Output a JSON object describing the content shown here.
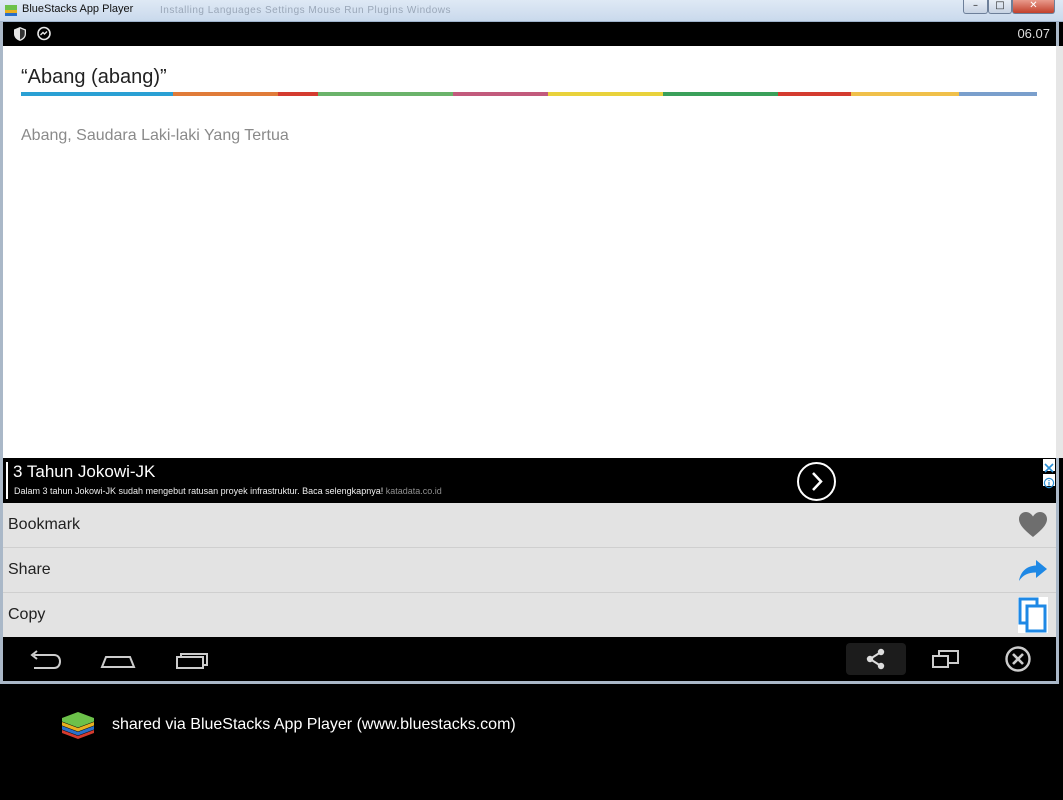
{
  "window": {
    "title": "BlueStacks App Player",
    "ghost_menu": "Installing   Languages   Settings   Mouse   Run   Plugins   Windows",
    "min_label": "–",
    "max_label": "□",
    "close_label": "✕"
  },
  "statusbar": {
    "time": "06.07",
    "icons": [
      "shield-icon",
      "messenger-icon"
    ]
  },
  "content": {
    "word": "“Abang (abang)”",
    "meaning": "Abang, Saudara Laki-laki Yang Tertua",
    "colorbar": [
      {
        "color": "#2aa0d4",
        "flex": 152
      },
      {
        "color": "#e07b39",
        "flex": 105
      },
      {
        "color": "#d43b2f",
        "flex": 40
      },
      {
        "color": "#6bb36b",
        "flex": 135
      },
      {
        "color": "#c25a7c",
        "flex": 95
      },
      {
        "color": "#e9d23b",
        "flex": 115
      },
      {
        "color": "#3aa05a",
        "flex": 115
      },
      {
        "color": "#d43b2f",
        "flex": 73
      },
      {
        "color": "#f0c04a",
        "flex": 108
      },
      {
        "color": "#7a9fcc",
        "flex": 78
      }
    ]
  },
  "ad": {
    "title": "3 Tahun Jokowi-JK",
    "description": "Dalam 3 tahun Jokowi-JK sudah mengebut ratusan proyek infrastruktur. Baca selengkapnya!",
    "domain": "katadata.co.id"
  },
  "menu": {
    "items": [
      {
        "label": "Bookmark",
        "icon": "heart-icon"
      },
      {
        "label": "Share",
        "icon": "share-arrow-icon"
      },
      {
        "label": "Copy",
        "icon": "copy-icon"
      }
    ]
  },
  "navbar": {
    "buttons": [
      "back-icon",
      "home-icon",
      "recent-apps-icon",
      "share-icon",
      "window-icon",
      "close-circle-icon"
    ]
  },
  "footer": {
    "text": "shared via BlueStacks App Player (www.bluestacks.com)"
  },
  "colors": {
    "accent_blue": "#1e88e5",
    "icon_gray": "#6e6e6e"
  }
}
